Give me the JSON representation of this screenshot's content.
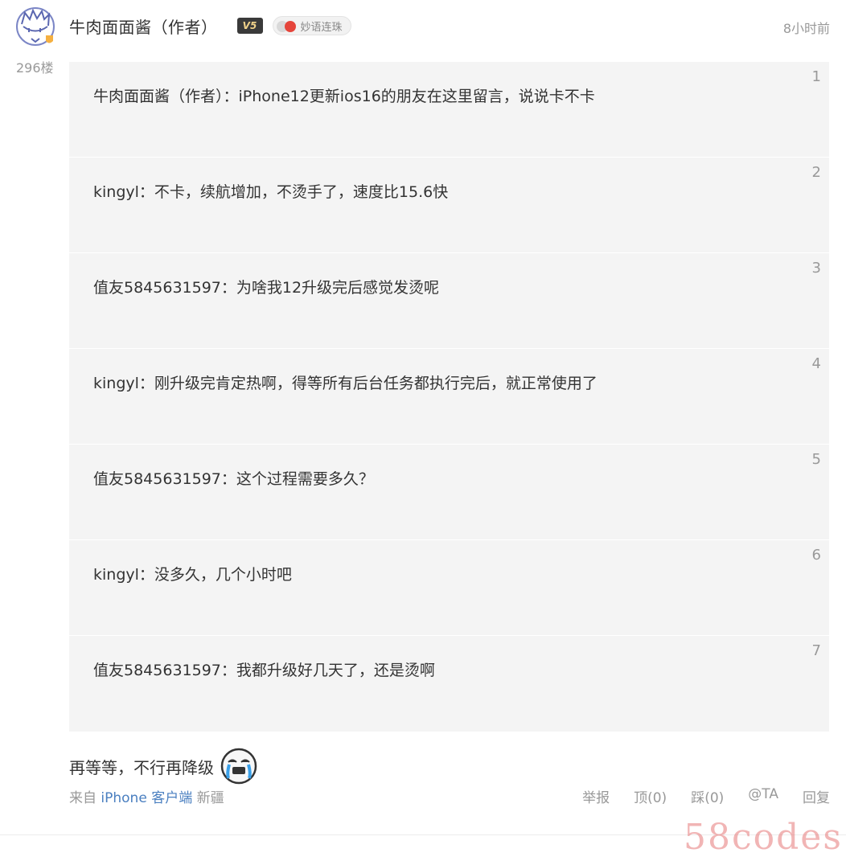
{
  "comment": {
    "username": "牛肉面面酱（作者）",
    "vip_badge": "V5",
    "combo_badge": "妙语连珠",
    "time": "8小时前",
    "floor": "296楼",
    "quotes": [
      {
        "text": "牛肉面面酱（作者）：iPhone12更新ios16的朋友在这里留言，说说卡不卡",
        "num": "1"
      },
      {
        "text": "kingyl：不卡，续航增加，不烫手了，速度比15.6快",
        "num": "2"
      },
      {
        "text": "值友5845631597：为啥我12升级完后感觉发烫呢",
        "num": "3"
      },
      {
        "text": "kingyl：刚升级完肯定热啊，得等所有后台任务都执行完后，就正常使用了",
        "num": "4"
      },
      {
        "text": "值友5845631597：这个过程需要多久？",
        "num": "5"
      },
      {
        "text": "kingyl：没多久，几个小时吧",
        "num": "6"
      },
      {
        "text": "值友5845631597：我都升级好几天了，还是烫啊",
        "num": "7"
      }
    ],
    "reply_text": "再等等，不行再降级",
    "source_prefix": "来自",
    "source_client": "iPhone 客户端",
    "source_location": "新疆",
    "actions": {
      "report": "举报",
      "up": "顶(0)",
      "down": "踩(0)",
      "mention": "@TA",
      "reply": "回复"
    }
  },
  "watermark": "58codes",
  "icons": {
    "avatar": "cartoon-avatar-icon",
    "emoji": "crying-face-icon"
  }
}
